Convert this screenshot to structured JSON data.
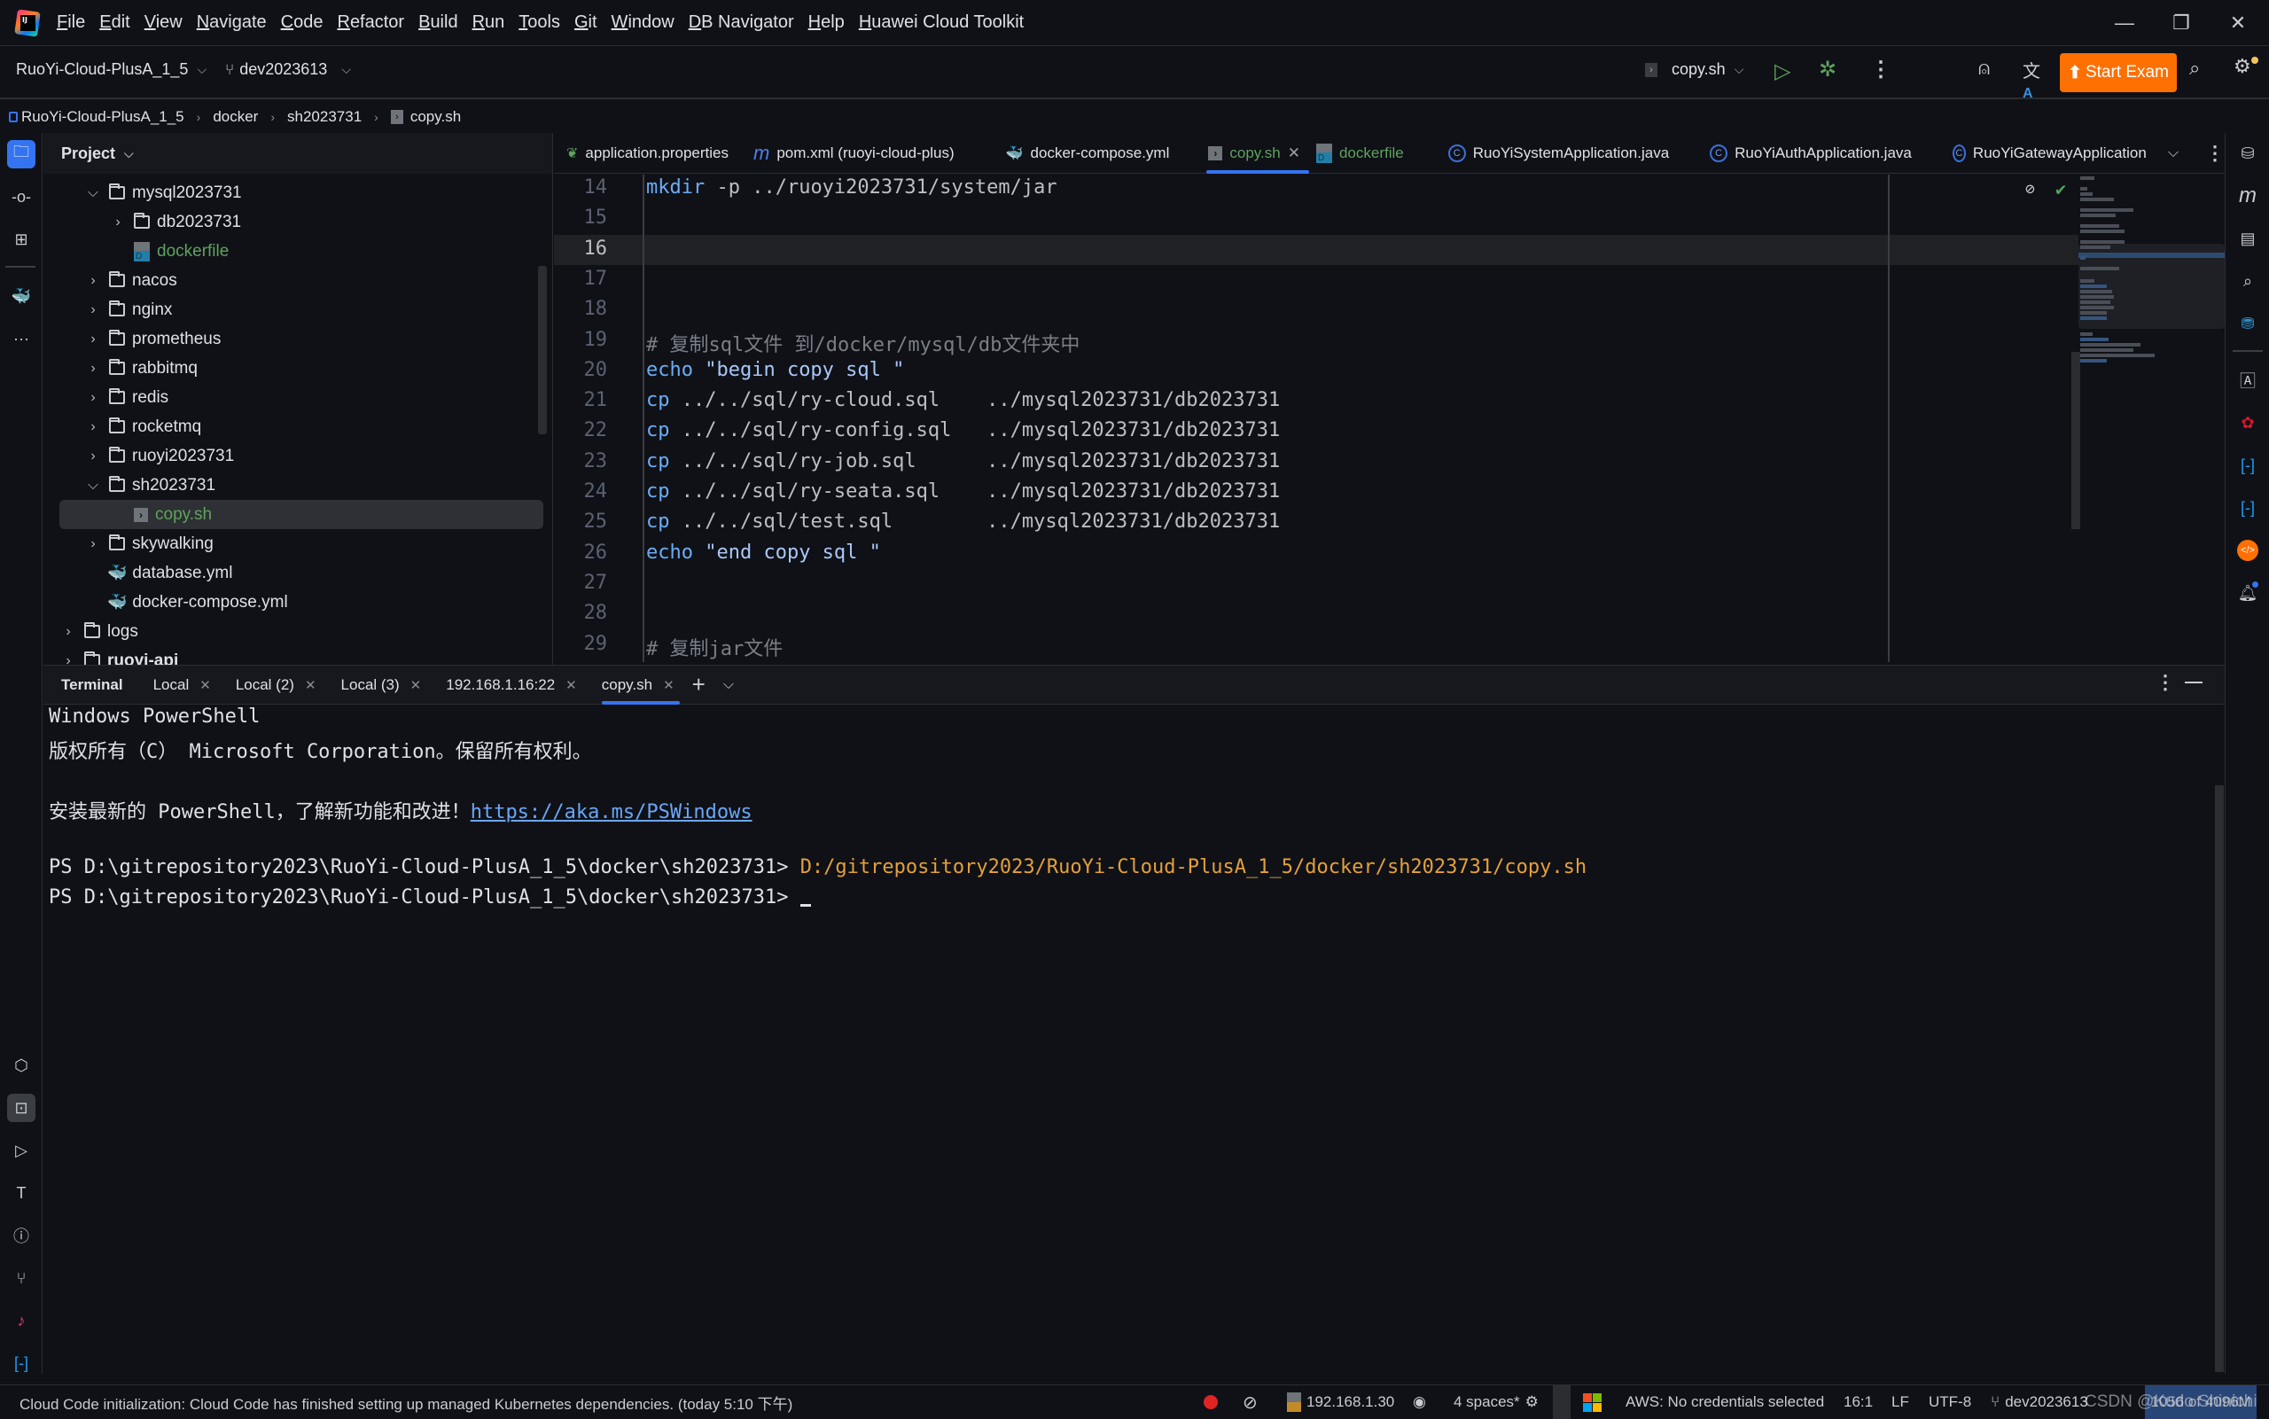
{
  "menu": {
    "items": [
      "File",
      "Edit",
      "View",
      "Navigate",
      "Code",
      "Refactor",
      "Build",
      "Run",
      "Tools",
      "Git",
      "Window",
      "DB Navigator",
      "Help",
      "Huawei Cloud Toolkit"
    ]
  },
  "toolbar": {
    "project_name": "RuoYi-Cloud-PlusA_1_5",
    "branch": "dev2023613",
    "run_config": "copy.sh",
    "start_exam_label": "Start Exam"
  },
  "breadcrumb": [
    "RuoYi-Cloud-PlusA_1_5",
    "docker",
    "sh2023731",
    "copy.sh"
  ],
  "project_panel": {
    "title": "Project",
    "tree": [
      {
        "label": "mysql2023731",
        "type": "folder",
        "expanded": true,
        "depth": 2
      },
      {
        "label": "db2023731",
        "type": "folder",
        "expanded": false,
        "depth": 3
      },
      {
        "label": "dockerfile",
        "type": "dockerfile",
        "depth": 3
      },
      {
        "label": "nacos",
        "type": "folder",
        "expanded": false,
        "depth": 2
      },
      {
        "label": "nginx",
        "type": "folder",
        "expanded": false,
        "depth": 2
      },
      {
        "label": "prometheus",
        "type": "folder",
        "expanded": false,
        "depth": 2
      },
      {
        "label": "rabbitmq",
        "type": "folder",
        "expanded": false,
        "depth": 2
      },
      {
        "label": "redis",
        "type": "folder",
        "expanded": false,
        "depth": 2
      },
      {
        "label": "rocketmq",
        "type": "folder",
        "expanded": false,
        "depth": 2
      },
      {
        "label": "ruoyi2023731",
        "type": "folder",
        "expanded": false,
        "depth": 2
      },
      {
        "label": "sh2023731",
        "type": "folder",
        "expanded": true,
        "depth": 2
      },
      {
        "label": "copy.sh",
        "type": "shell",
        "depth": 3,
        "selected": true
      },
      {
        "label": "skywalking",
        "type": "folder",
        "expanded": false,
        "depth": 2
      },
      {
        "label": "database.yml",
        "type": "docker-yml",
        "depth": 2
      },
      {
        "label": "docker-compose.yml",
        "type": "docker-yml",
        "depth": 2
      },
      {
        "label": "logs",
        "type": "folder",
        "expanded": false,
        "depth": 1
      },
      {
        "label": "ruoyi-api",
        "type": "module",
        "expanded": false,
        "depth": 1
      }
    ]
  },
  "editor_tabs": [
    {
      "label": "application.properties",
      "icon": "spring-icon"
    },
    {
      "label": "pom.xml (ruoyi-cloud-plus)",
      "icon": "maven-icon"
    },
    {
      "label": "docker-compose.yml",
      "icon": "docker-icon"
    },
    {
      "label": "copy.sh",
      "icon": "shell-icon",
      "active": true
    },
    {
      "label": "dockerfile",
      "icon": "dockerfile-icon"
    },
    {
      "label": "RuoYiSystemApplication.java",
      "icon": "java-class-icon"
    },
    {
      "label": "RuoYiAuthApplication.java",
      "icon": "java-class-icon"
    },
    {
      "label": "RuoYiGatewayApplication",
      "icon": "java-class-icon"
    }
  ],
  "editor": {
    "current_line": 16,
    "lines": [
      {
        "n": "14",
        "kw": "mkdir",
        "rest": " -p ../ruoyi2023731/system/jar"
      },
      {
        "n": "15",
        "kw": "",
        "rest": ""
      },
      {
        "n": "16",
        "kw": "",
        "rest": ""
      },
      {
        "n": "17",
        "kw": "",
        "rest": ""
      },
      {
        "n": "18",
        "kw": "",
        "rest": ""
      },
      {
        "n": "19",
        "comment": "# 复制sql文件 到/docker/mysql/db文件夹中"
      },
      {
        "n": "20",
        "kw": "echo",
        "str": " \"begin copy sql \""
      },
      {
        "n": "21",
        "kw": "cp",
        "rest": " ../../sql/ry-cloud.sql    ../mysql2023731/db2023731"
      },
      {
        "n": "22",
        "kw": "cp",
        "rest": " ../../sql/ry-config.sql   ../mysql2023731/db2023731"
      },
      {
        "n": "23",
        "kw": "cp",
        "rest": " ../../sql/ry-job.sql      ../mysql2023731/db2023731"
      },
      {
        "n": "24",
        "kw": "cp",
        "rest": " ../../sql/ry-seata.sql    ../mysql2023731/db2023731"
      },
      {
        "n": "25",
        "kw": "cp",
        "rest": " ../../sql/test.sql        ../mysql2023731/db2023731"
      },
      {
        "n": "26",
        "kw": "echo",
        "str": " \"end copy sql \""
      },
      {
        "n": "27",
        "kw": "",
        "rest": ""
      },
      {
        "n": "28",
        "kw": "",
        "rest": ""
      },
      {
        "n": "29",
        "comment": "# 复制jar文件"
      }
    ]
  },
  "terminal": {
    "title": "Terminal",
    "tabs": [
      {
        "label": "Local"
      },
      {
        "label": "Local (2)"
      },
      {
        "label": "Local (3)"
      },
      {
        "label": "192.168.1.16:22"
      },
      {
        "label": "copy.sh",
        "active": true
      }
    ],
    "lines": {
      "l1": "Windows PowerShell",
      "l2": "版权所有（C） Microsoft Corporation。保留所有权利。",
      "l3_prefix": "安装最新的 PowerShell，了解新功能和改进！",
      "l3_link": "https://aka.ms/PSWindows",
      "prompt": "PS D:\\gitrepository2023\\RuoYi-Cloud-PlusA_1_5\\docker\\sh2023731> ",
      "cmd": "D:/gitrepository2023/RuoYi-Cloud-PlusA_1_5/docker/sh2023731/copy.sh"
    }
  },
  "statusbar": {
    "message": "Cloud Code initialization: Cloud Code has finished setting up managed Kubernetes dependencies. (today 5:10 下午)",
    "sftp_host": "192.168.1.30",
    "indent": "4 spaces*",
    "aws": "AWS: No credentials selected",
    "position": "16:1",
    "line_sep": "LF",
    "encoding": "UTF-8",
    "branch": "dev2023613",
    "memory": "1056 of 4096M",
    "watermark": "CSDN @Kudo Shinichi"
  },
  "colors": {
    "accent": "#3574f0",
    "start_exam": "#ff7002",
    "vcs_added": "#5fa35c",
    "terminal_cmd": "#e5a03a",
    "link": "#6aa7f7"
  }
}
